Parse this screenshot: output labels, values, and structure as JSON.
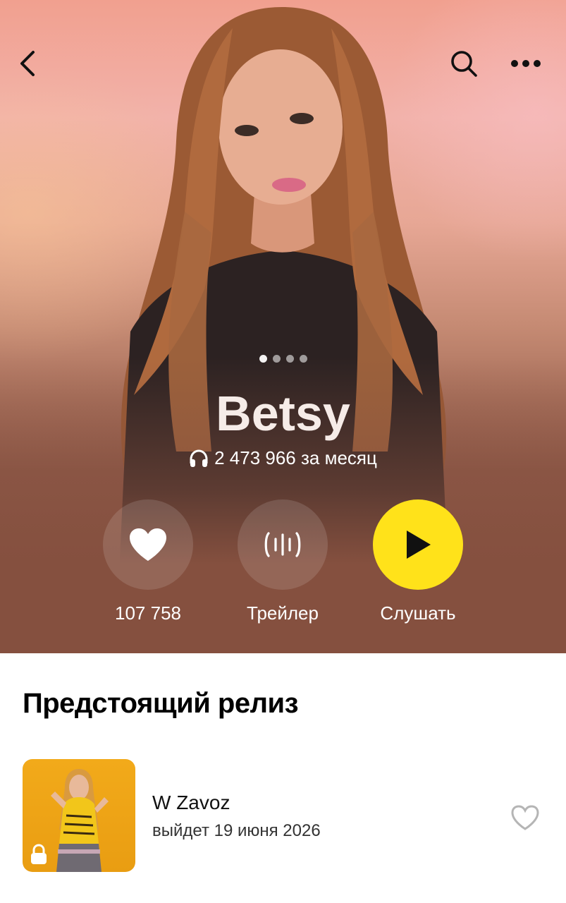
{
  "artist": {
    "name": "Betsy",
    "listeners": "2 473 966 за месяц"
  },
  "header": {
    "back_icon": "chevron-left-icon",
    "search_icon": "search-icon",
    "more_icon": "more-horizontal-icon"
  },
  "gallery": {
    "page_count": 4,
    "active_index": 0
  },
  "actions": {
    "like_count": "107 758",
    "trailer_label": "Трейлер",
    "listen_label": "Слушать"
  },
  "colors": {
    "accent_play": "#ffe21a",
    "hero_bottom": "#85503f"
  },
  "upcoming": {
    "section_title": "Предстоящий релиз",
    "release": {
      "title": "W Zavoz",
      "date": "выйдет 19 июня 2026",
      "locked_icon": "lock-icon",
      "favorite_icon": "heart-outline-icon"
    }
  }
}
